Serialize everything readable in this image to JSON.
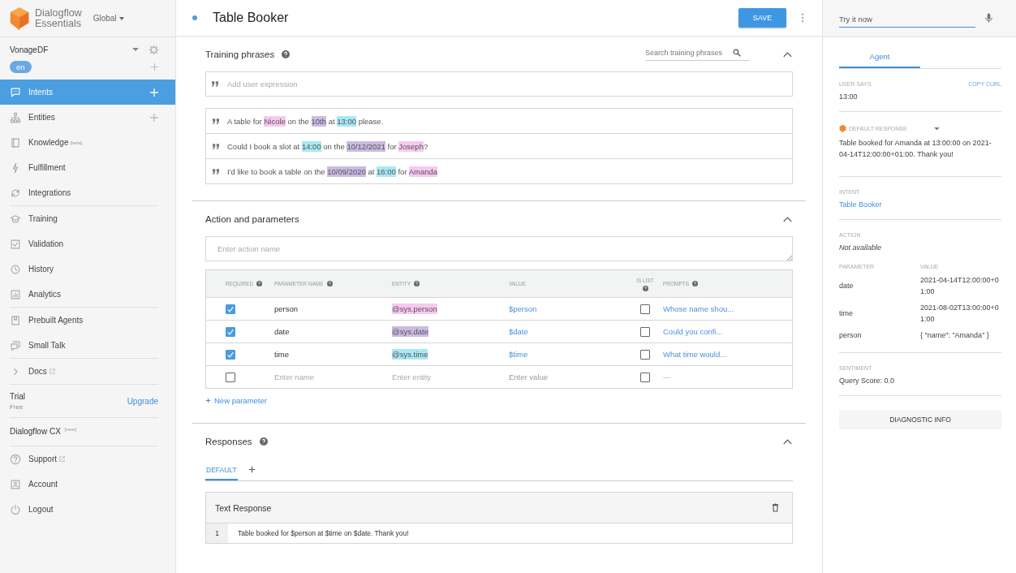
{
  "sidebar": {
    "logo": {
      "line1": "Dialogflow",
      "line2": "Essentials"
    },
    "region": "Global",
    "agent": "VonageDF",
    "language": "en",
    "groups": [
      [
        {
          "label": "Intents",
          "selected": true,
          "add": true
        },
        {
          "label": "Entities",
          "selected": false,
          "add": true
        },
        {
          "label": "Knowledge",
          "tag": "[beta]",
          "selected": false
        },
        {
          "label": "Fulfillment",
          "selected": false
        },
        {
          "label": "Integrations",
          "selected": false
        }
      ],
      [
        {
          "label": "Training",
          "selected": false
        },
        {
          "label": "Validation",
          "selected": false
        },
        {
          "label": "History",
          "selected": false
        },
        {
          "label": "Analytics",
          "selected": false
        }
      ],
      [
        {
          "label": "Prebuilt Agents",
          "selected": false
        },
        {
          "label": "Small Talk",
          "selected": false
        }
      ],
      [
        {
          "label": "Docs",
          "selected": false,
          "external": true
        }
      ]
    ],
    "trial": {
      "label": "Trial",
      "sub": "Free",
      "link": "Upgrade"
    },
    "cx": {
      "label": "Dialogflow CX",
      "tag": "[new]"
    },
    "footer": [
      {
        "label": "Support",
        "selected": false,
        "external": true
      },
      {
        "label": "Account",
        "selected": false
      },
      {
        "label": "Logout",
        "selected": false
      }
    ]
  },
  "header": {
    "title": "Table Booker",
    "save": "SAVE"
  },
  "training": {
    "title": "Training phrases",
    "search_placeholder": "Search training phrases",
    "add_placeholder": "Add user expression",
    "phrases": [
      [
        {
          "text": "A table for "
        },
        {
          "text": "Nicole",
          "color": "#f7c9ef"
        },
        {
          "text": " on the "
        },
        {
          "text": "10th",
          "color": "#cbbbe2"
        },
        {
          "text": " at "
        },
        {
          "text": "13:00",
          "color": "#a9e8f4"
        },
        {
          "text": " please."
        }
      ],
      [
        {
          "text": "Could I book a slot at "
        },
        {
          "text": "14:00",
          "color": "#a9e8f4"
        },
        {
          "text": " on the "
        },
        {
          "text": "10/12/2021",
          "color": "#cbbbe2"
        },
        {
          "text": " for "
        },
        {
          "text": "Joseph",
          "color": "#f7c9ef"
        },
        {
          "text": "?"
        }
      ],
      [
        {
          "text": "I'd like to book a table on the "
        },
        {
          "text": "10/09/2020",
          "color": "#cbbbe2"
        },
        {
          "text": " at "
        },
        {
          "text": "16:00",
          "color": "#a9e8f4"
        },
        {
          "text": " for "
        },
        {
          "text": "Amanda",
          "color": "#f7c9ef"
        }
      ]
    ]
  },
  "action": {
    "title": "Action and parameters",
    "placeholder": "Enter action name",
    "columns": [
      {
        "label": "REQUIRED",
        "help": true
      },
      {
        "label": "PARAMETER NAME",
        "help": true
      },
      {
        "label": "ENTITY",
        "help": true
      },
      {
        "label": "VALUE",
        "help": false
      },
      {
        "label": "IS LIST",
        "help": true
      },
      {
        "label": "PROMPTS",
        "help": true
      }
    ],
    "rows": [
      {
        "kind": "param",
        "required": true,
        "name": "person",
        "entity": "@sys.person",
        "color": "#f7c9ef",
        "value": "$person",
        "is_list": false,
        "prompt": "Whose name shou..."
      },
      {
        "kind": "param",
        "required": true,
        "name": "date",
        "entity": "@sys.date",
        "color": "#cbbbe2",
        "value": "$date",
        "is_list": false,
        "prompt": "Could you confi..."
      },
      {
        "kind": "param",
        "required": true,
        "name": "time",
        "entity": "@sys.time",
        "color": "#a9e8f4",
        "value": "$time",
        "is_list": false,
        "prompt": "What time would..."
      },
      {
        "kind": "empty",
        "required": false,
        "name_placeholder": "Enter name",
        "entity_placeholder": "Enter entity",
        "value_placeholder": "Enter value",
        "is_list": false,
        "prompt": "—"
      }
    ],
    "new_parameter": "New parameter"
  },
  "responses": {
    "title": "Responses",
    "tabs": [
      {
        "label": "DEFAULT",
        "selected": true
      }
    ],
    "card_title": "Text Response",
    "lines": [
      {
        "number": "1",
        "text": "Table booked for $person at $time on $date. Thank you!"
      }
    ]
  },
  "console": {
    "placeholder": "Try it now",
    "tabs": [
      {
        "label": "Agent",
        "selected": true
      }
    ],
    "user_says_label": "USER SAYS",
    "copy": "COPY CURL",
    "query": "13:00",
    "response_label": "DEFAULT RESPONSE",
    "response": "Table booked for Amanda at 13:00:00 on 2021-04-14T12:00:00+01:00. Thank you!",
    "intent_label": "INTENT",
    "intent": "Table Booker",
    "action_label": "ACTION",
    "action": "Not available",
    "param_headers": [
      "PARAMETER",
      "VALUE"
    ],
    "params": [
      {
        "name": "date",
        "value": "2021-04-14T12:00:00+01:00"
      },
      {
        "name": "time",
        "value": "2021-08-02T13:00:00+01:00"
      },
      {
        "name": "person",
        "value": "{ \"name\": \"Amanda\" }"
      }
    ],
    "sentiment_label": "SENTIMENT",
    "sentiment": "Query Score: 0.0",
    "diagnostic": "DIAGNOSTIC INFO"
  }
}
